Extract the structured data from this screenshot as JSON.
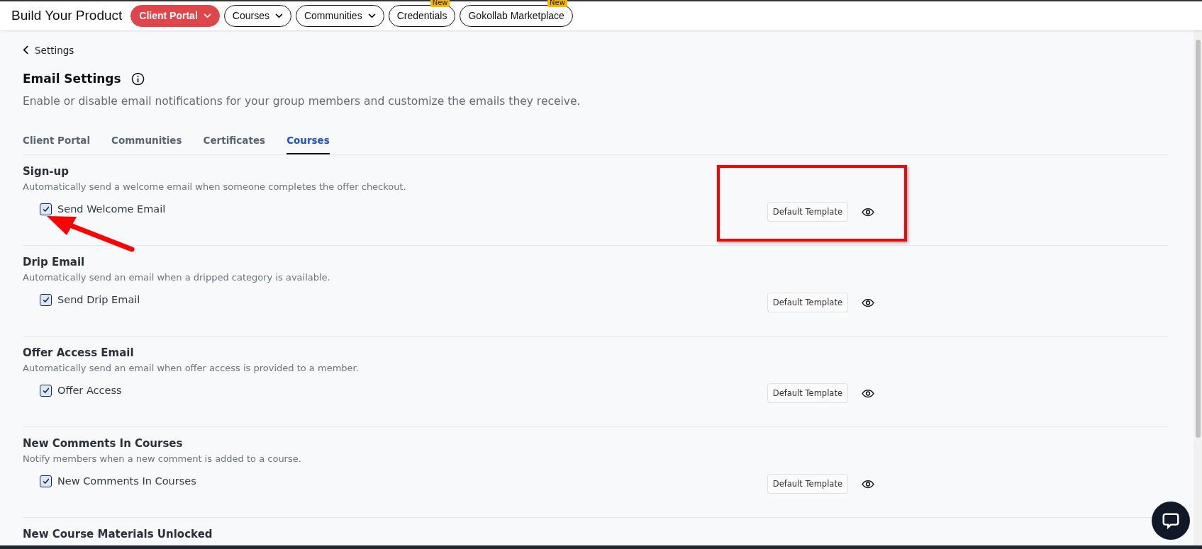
{
  "app_title": "Build Your Product",
  "nav": [
    {
      "label": "Client Portal",
      "selected": true,
      "dropdown": true
    },
    {
      "label": "Courses",
      "selected": false,
      "dropdown": true
    },
    {
      "label": "Communities",
      "selected": false,
      "dropdown": true
    },
    {
      "label": "Credentials",
      "selected": false,
      "dropdown": false,
      "badge": "New"
    },
    {
      "label": "Gokollab Marketplace",
      "selected": false,
      "dropdown": false,
      "badge": "New"
    }
  ],
  "back_link": "Settings",
  "page": {
    "title": "Email Settings",
    "subtitle": "Enable or disable email notifications for your group members and customize the emails they receive."
  },
  "tabs": [
    {
      "label": "Client Portal",
      "selected": false
    },
    {
      "label": "Communities",
      "selected": false
    },
    {
      "label": "Certificates",
      "selected": false
    },
    {
      "label": "Courses",
      "selected": true
    }
  ],
  "sections": [
    {
      "title": "Sign-up",
      "description": "Automatically send a welcome email when someone completes the offer checkout.",
      "option": "Send Welcome Email",
      "checked": true,
      "template": "Default Template"
    },
    {
      "title": "Drip Email",
      "description": "Automatically send an email when a dripped category is available.",
      "option": "Send Drip Email",
      "checked": true,
      "template": "Default Template"
    },
    {
      "title": "Offer Access Email",
      "description": "Automatically send an email when offer access is provided to a member.",
      "option": "Offer Access",
      "checked": true,
      "template": "Default Template"
    },
    {
      "title": "New Comments In Courses",
      "description": "Notify members when a new comment is added to a course.",
      "option": "New Comments In Courses",
      "checked": true,
      "template": "Default Template"
    },
    {
      "title": "New Course Materials Unlocked"
    }
  ]
}
